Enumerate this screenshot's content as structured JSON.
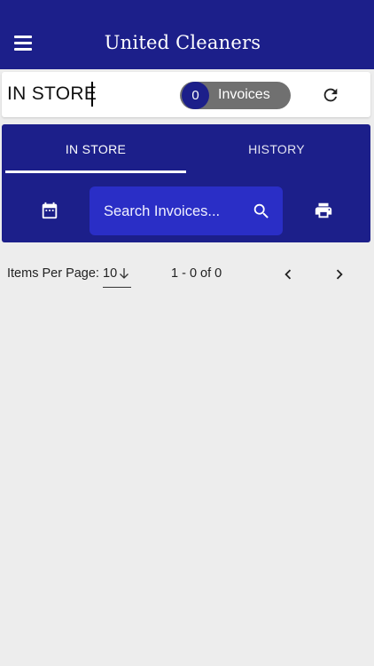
{
  "appbar": {
    "title": "United Cleaners",
    "menu_icon": "menu-icon"
  },
  "status": {
    "store_label": "IN STORE",
    "invoice_count": "0",
    "invoice_label": "Invoices",
    "refresh_icon": "refresh-icon"
  },
  "tabs": [
    {
      "label": "IN STORE",
      "active": true
    },
    {
      "label": "HISTORY",
      "active": false
    }
  ],
  "toolbar": {
    "calendar_icon": "calendar-icon",
    "search_placeholder": "Search Invoices...",
    "search_value": "",
    "search_icon": "search-icon",
    "print_icon": "print-icon"
  },
  "pagination": {
    "items_per_page_label": "Items Per Page:",
    "items_per_page_value": "10",
    "range": "1 - 0 of 0"
  },
  "colors": {
    "primary": "#1c1f8a",
    "search_bg": "#2a2ec6",
    "pill_bg": "#707070",
    "background": "#ededed"
  }
}
